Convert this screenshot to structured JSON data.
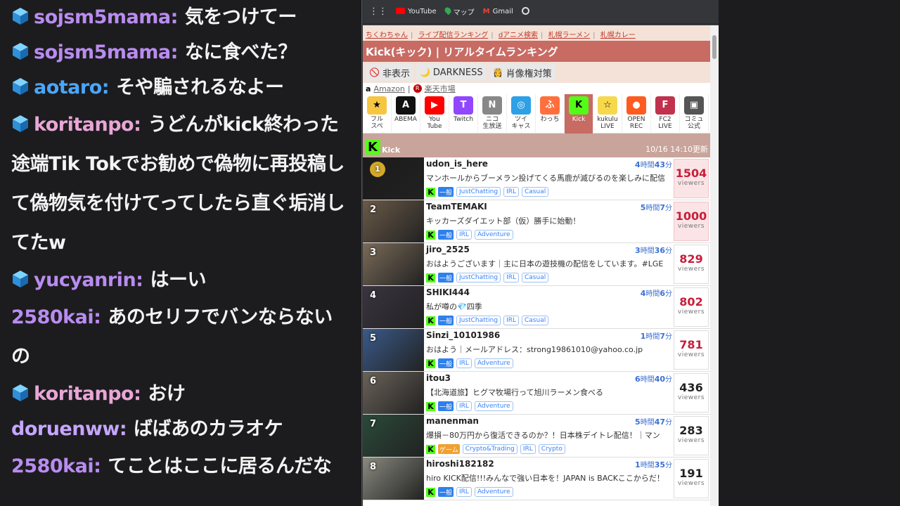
{
  "chat": [
    {
      "user": "sojsm5mama",
      "color": "#b98cf0",
      "cube": true,
      "text": "気をつけてー",
      "wrap": false
    },
    {
      "user": "sojsm5mama",
      "color": "#b98cf0",
      "cube": true,
      "text": "なに食べた？",
      "wrap": false
    },
    {
      "user": "aotaro",
      "color": "#4aa6ff",
      "cube": true,
      "text": "そや騙されるなよー",
      "wrap": false
    },
    {
      "user": "koritanpo",
      "color": "#e8a6d6",
      "cube": true,
      "text": "うどんがkick終わった途端Tik Tokでお勧めで偽物に再投稿して偽物気を付けてってしたら直ぐ垢消してたw",
      "wrap": true
    },
    {
      "user": "yucyanrin",
      "color": "#b98cf0",
      "cube": true,
      "text": "はーい",
      "wrap": false
    },
    {
      "user": "2580kai",
      "color": "#b98cf0",
      "cube": false,
      "text": "あのセリフでバンならないの",
      "wrap": true
    },
    {
      "user": "koritanpo",
      "color": "#e8a6d6",
      "cube": true,
      "text": "おけ",
      "wrap": false
    },
    {
      "user": "doruenww",
      "color": "#c6a6ff",
      "cube": false,
      "text": "ばばあのカラオケ",
      "wrap": false
    },
    {
      "user": "2580kai",
      "color": "#b98cf0",
      "cube": false,
      "text": "てことはここに居るんだな",
      "wrap": true
    }
  ],
  "bookmarks": [
    {
      "label": "YouTube",
      "icon": "youtube-icon"
    },
    {
      "label": "マップ",
      "icon": "maps-icon"
    },
    {
      "label": "Gmail",
      "icon": "gmail-icon"
    },
    {
      "label": "",
      "icon": "globe-icon"
    }
  ],
  "toplinks": [
    "ちくわちゃん",
    "ライブ配信ランキング",
    "dアニメ検索",
    "札幌ラーメン",
    "札幌カレー"
  ],
  "page_title": "Kick(キック) | リアルタイムランキング",
  "toggle_buttons": [
    {
      "label": "非表示",
      "icon": "no-entry-icon"
    },
    {
      "label": "DARKNESS",
      "icon": "moon-icon"
    },
    {
      "label": "肖像権対策",
      "icon": "portrait-icon"
    }
  ],
  "amazon": {
    "label": "Amazon",
    "rakuten": "楽天市場"
  },
  "platforms": [
    {
      "label": "フル\nスペ",
      "bg": "#f6c643",
      "sym": "★"
    },
    {
      "label": "ABEMA",
      "bg": "#111",
      "sym": "A"
    },
    {
      "label": "You\nTube",
      "bg": "#ff0000",
      "sym": "▶"
    },
    {
      "label": "Twitch",
      "bg": "#9146ff",
      "sym": "T"
    },
    {
      "label": "ニコ\n生放送",
      "bg": "#888",
      "sym": "N"
    },
    {
      "label": "ツイ\nキャス",
      "bg": "#2ea0e6",
      "sym": "◎"
    },
    {
      "label": "わっち",
      "bg": "#ff6f3c",
      "sym": "ふ"
    },
    {
      "label": "Kick",
      "bg": "#53fc18",
      "sym": "K",
      "active": true
    },
    {
      "label": "kukulu\nLIVE",
      "bg": "#f6d84d",
      "sym": "☆"
    },
    {
      "label": "OPEN\nREC",
      "bg": "#ff5a1f",
      "sym": "●"
    },
    {
      "label": "FC2\nLIVE",
      "bg": "#c0314e",
      "sym": "F"
    },
    {
      "label": "コミュ\n公式",
      "bg": "#555",
      "sym": "▣"
    }
  ],
  "section": {
    "name": "Kick",
    "updated": "10/16 14:10更新"
  },
  "streams": [
    {
      "rank": "1",
      "user": "udon_is_here",
      "hours": "4",
      "mins": "43",
      "desc": "マンホールからブーメラン投げてくる馬鹿が滅びるのを楽しみに配信",
      "cat": "一般",
      "tags": [
        "JustChatting",
        "IRL",
        "Casual"
      ],
      "viewers": "1504",
      "level": "hot",
      "thumb": "#1a1a1a"
    },
    {
      "rank": "2",
      "user": "TeamTEMAKI",
      "hours": "5",
      "mins": "7",
      "desc": "キッカーズダイエット部（仮）勝手に始動！",
      "cat": "一般",
      "tags": [
        "IRL",
        "Adventure"
      ],
      "viewers": "1000",
      "level": "hot",
      "thumb": "#6a5a48"
    },
    {
      "rank": "3",
      "user": "jiro_2525",
      "hours": "3",
      "mins": "36",
      "desc": "おはようございます｜主に日本の遊技機の配信をしています。#LGE",
      "cat": "一般",
      "tags": [
        "JustChatting",
        "IRL",
        "Casual"
      ],
      "viewers": "829",
      "level": "warm",
      "thumb": "#7a6a58"
    },
    {
      "rank": "4",
      "user": "SHIKI444",
      "hours": "4",
      "mins": "6",
      "desc": "私が噂の💎四季",
      "cat": "一般",
      "tags": [
        "JustChatting",
        "IRL",
        "Casual"
      ],
      "viewers": "802",
      "level": "warm",
      "thumb": "#3a3440"
    },
    {
      "rank": "5",
      "user": "Sinzi_10101986",
      "hours": "1",
      "mins": "7",
      "desc": "おはよう｜メールアドレス：strong19861010@yahoo.co.jp",
      "cat": "一般",
      "tags": [
        "IRL",
        "Adventure"
      ],
      "viewers": "781",
      "level": "warm",
      "thumb": "#3a5a8a"
    },
    {
      "rank": "6",
      "user": "itou3",
      "hours": "6",
      "mins": "40",
      "desc": "【北海道旅】ヒグマ牧場行って旭川ラーメン食べる",
      "cat": "一般",
      "tags": [
        "IRL",
        "Adventure"
      ],
      "viewers": "436",
      "level": "",
      "thumb": "#6a6258"
    },
    {
      "rank": "7",
      "user": "manenman",
      "hours": "5",
      "mins": "47",
      "desc": "爆損－80万円から復活できるのか？！日本株デイトレ配信！｜マン",
      "cat": "ゲーム",
      "tags": [
        "Crypto&Trading",
        "IRL",
        "Crypto"
      ],
      "viewers": "283",
      "level": "",
      "thumb": "#2a4a3a"
    },
    {
      "rank": "8",
      "user": "hiroshi182182",
      "hours": "1",
      "mins": "35",
      "desc": "hiro KICK配信!!!みんなで強い日本を！JAPAN is BACKここからだ！",
      "cat": "一般",
      "tags": [
        "IRL",
        "Adventure"
      ],
      "viewers": "191",
      "level": "",
      "thumb": "#8a8a80"
    }
  ],
  "labels": {
    "viewers": "viewers",
    "hours_unit": "時間",
    "mins_unit": "分"
  }
}
